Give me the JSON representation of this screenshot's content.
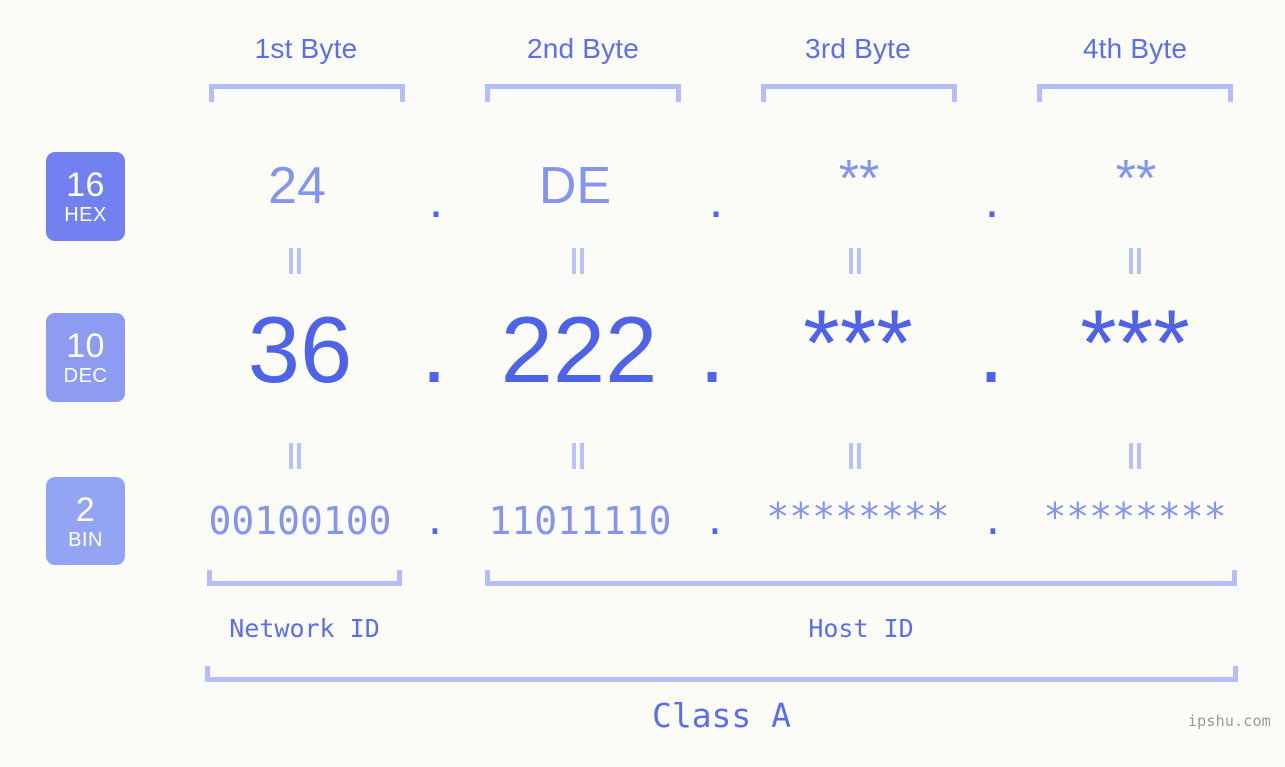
{
  "background_color": "#fcfdf8",
  "accent_strong": "#4f63e8",
  "accent_mid": "#8494f2",
  "accent_light": "#b4bef9",
  "byte_headers": [
    {
      "label": "1st Byte"
    },
    {
      "label": "2nd Byte"
    },
    {
      "label": "3rd Byte"
    },
    {
      "label": "4th Byte"
    }
  ],
  "bases": [
    {
      "number": "16",
      "name": "HEX",
      "color": "#7281ef"
    },
    {
      "number": "10",
      "name": "DEC",
      "color": "#8e9bf2"
    },
    {
      "number": "2",
      "name": "BIN",
      "color": "#94a4f5"
    }
  ],
  "rows": {
    "hex": {
      "values": [
        "24",
        "DE",
        "**",
        "**"
      ],
      "separator": "."
    },
    "dec": {
      "values": [
        "36",
        "222",
        "***",
        "***"
      ],
      "separator": "."
    },
    "bin": {
      "values": [
        "00100100",
        "11011110",
        "********",
        "********"
      ],
      "separator": "."
    }
  },
  "equals_symbol": "=",
  "id_labels": {
    "network": "Network ID",
    "host": "Host ID"
  },
  "class_label": "Class A",
  "watermark": "ipshu.com"
}
